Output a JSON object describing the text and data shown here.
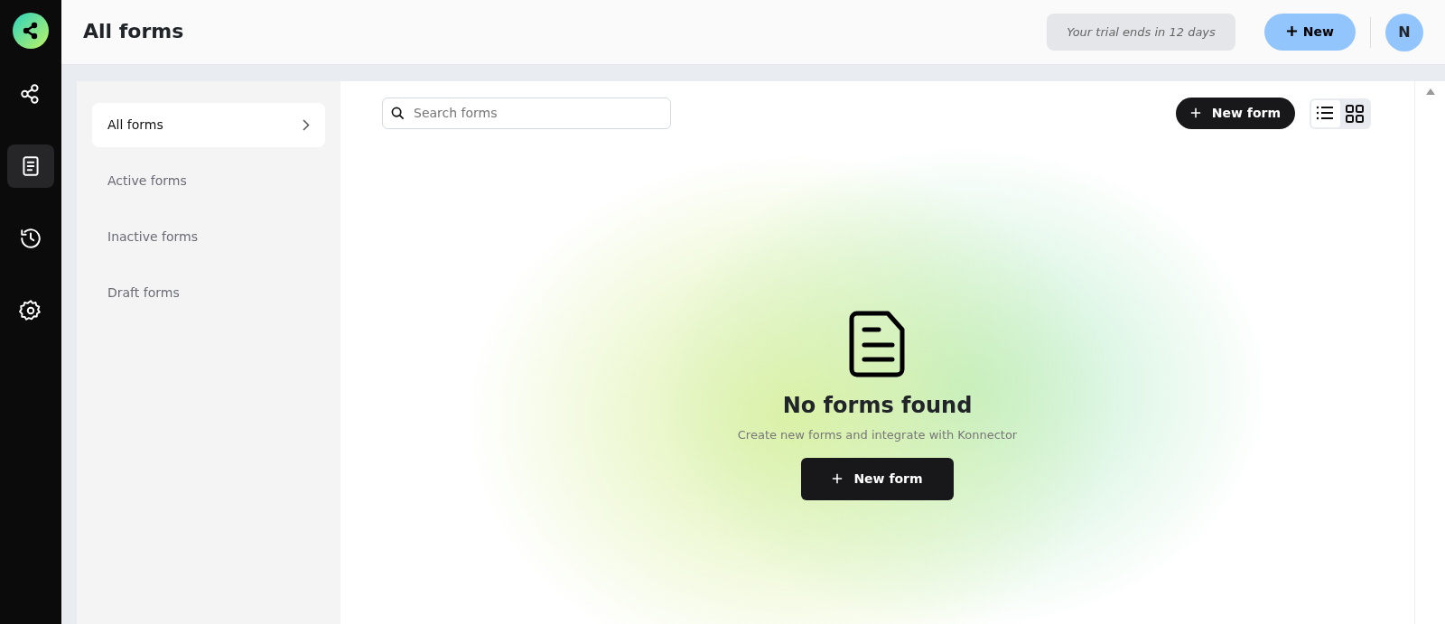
{
  "header": {
    "title": "All forms",
    "trial": "Your trial ends in 12 days",
    "new_button": "New",
    "avatar": "N"
  },
  "rail": [
    {
      "kind": "share",
      "selected": false
    },
    {
      "kind": "form",
      "selected": true
    },
    {
      "kind": "history",
      "selected": false
    },
    {
      "kind": "settings",
      "selected": false
    }
  ],
  "filters": [
    {
      "label": "All forms",
      "selected": true
    },
    {
      "label": "Active forms",
      "selected": false
    },
    {
      "label": "Inactive forms",
      "selected": false
    },
    {
      "label": "Draft forms",
      "selected": false
    }
  ],
  "search": {
    "placeholder": "Search forms"
  },
  "toolbar": {
    "new_form": "New form",
    "views": [
      {
        "kind": "list",
        "selected": true
      },
      {
        "kind": "grid",
        "selected": false
      }
    ]
  },
  "empty": {
    "title": "No forms found",
    "text": "Create new forms and integrate with Konnector",
    "button": "New form"
  }
}
